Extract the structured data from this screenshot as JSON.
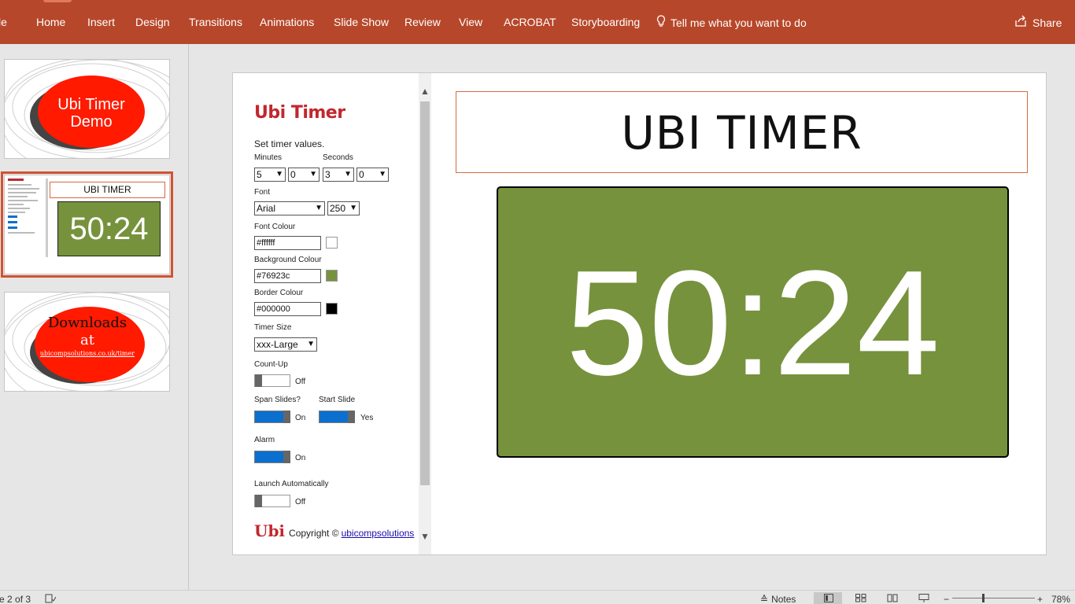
{
  "ribbon": {
    "tabs": [
      "le",
      "Home",
      "Insert",
      "Design",
      "Transitions",
      "Animations",
      "Slide Show",
      "Review",
      "View",
      "ACROBAT",
      "Storyboarding"
    ],
    "tell_me": "Tell me what you want to do",
    "share": "Share"
  },
  "thumbnails": [
    {
      "line1": "Ubi Timer",
      "line2": "Demo"
    },
    {
      "title": "UBI TIMER",
      "timer": "50:24"
    },
    {
      "line1": "Downloads",
      "line2": "at",
      "line3": "ubicompsolutions.co.uk/timer"
    }
  ],
  "addin": {
    "title": "Ubi Timer",
    "subtitle": "Set timer values.",
    "minutes_label": "Minutes",
    "seconds_label": "Seconds",
    "minutes_values": [
      "5",
      "0"
    ],
    "seconds_values": [
      "3",
      "0"
    ],
    "font_label": "Font",
    "font_value": "Arial",
    "font_size_value": "250",
    "font_colour_label": "Font Colour",
    "font_colour_value": "#ffffff",
    "bg_colour_label": "Background Colour",
    "bg_colour_value": "#76923c",
    "border_colour_label": "Border Colour",
    "border_colour_value": "#000000",
    "timer_size_label": "Timer Size",
    "timer_size_value": "xxx-Large",
    "count_up_label": "Count-Up",
    "count_up_state": "Off",
    "span_slides_label": "Span Slides?",
    "span_slides_state": "On",
    "start_slide_label": "Start Slide",
    "start_slide_state": "Yes",
    "alarm_label": "Alarm",
    "alarm_state": "On",
    "launch_label": "Launch Automatically",
    "launch_state": "Off",
    "copyright": "Copyright ©",
    "copyright_link": "ubicompsolutions",
    "logo_text": "Ubi"
  },
  "slide": {
    "title": "UBI TIMER",
    "timer": "50:24"
  },
  "statusbar": {
    "slide_info": "e 2 of 3",
    "notes": "Notes",
    "zoom": "78%"
  },
  "colors": {
    "ribbon": "#b7472a",
    "timer_bg": "#76923c",
    "thumb_red": "#ff1a00",
    "link": "#1a0dab"
  }
}
